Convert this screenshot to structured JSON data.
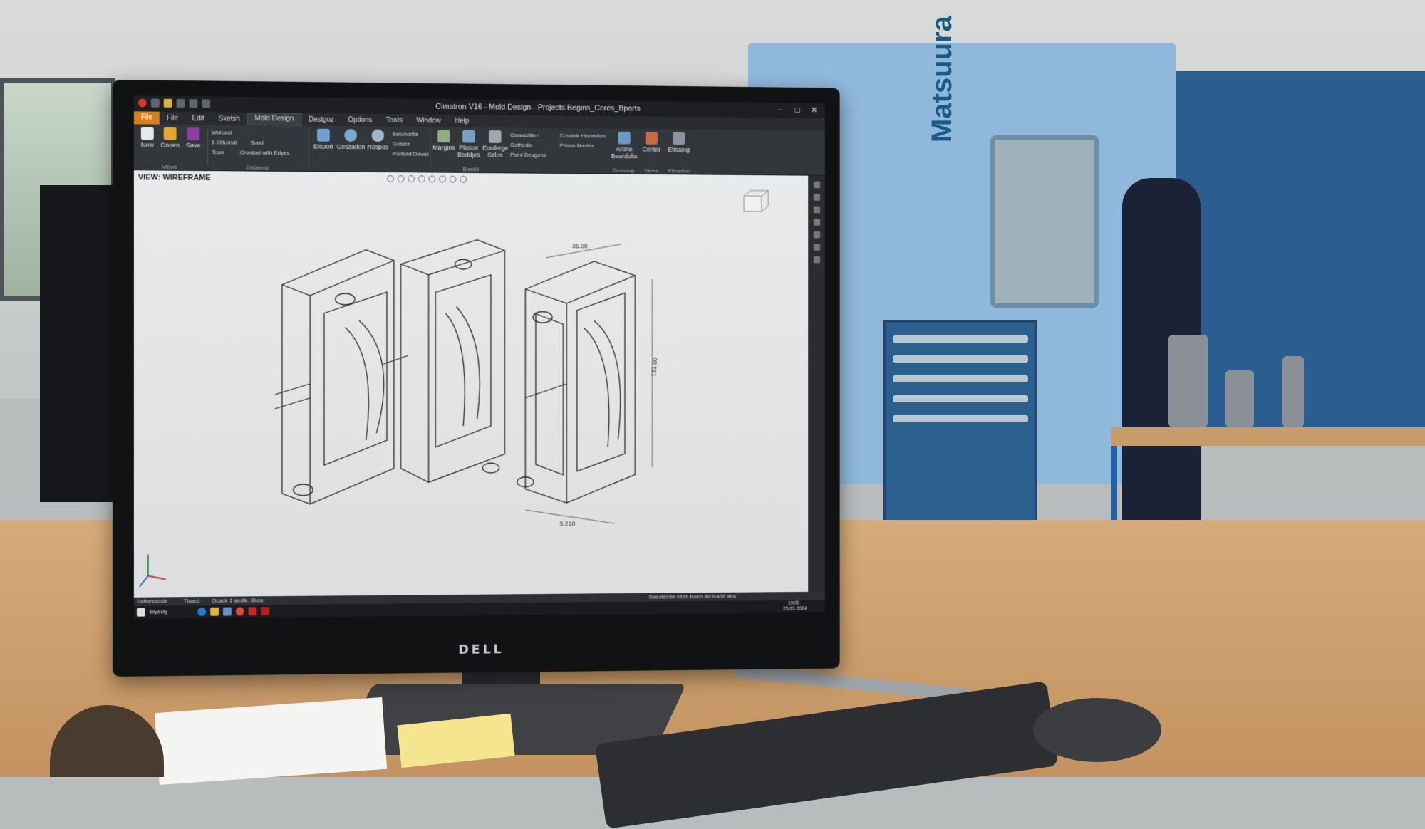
{
  "window": {
    "title": "Cimatron V16 - Mold Design - Projects Begins_Cores_Bparts",
    "minimize": "–",
    "maximize": "□",
    "close": "✕"
  },
  "menu": {
    "file": "File",
    "items": [
      "File",
      "Edit",
      "Sketsh",
      "Mold Design",
      "Destgoz",
      "Options",
      "Tools",
      "Window",
      "Help"
    ]
  },
  "ribbon": {
    "new": "New",
    "open": "Cooen",
    "save": "Save",
    "views_group": "Views",
    "woloasi": "Woloasi",
    "elitomat": "6 Elitomat",
    "sond": "Sond",
    "toon": "Toon",
    "orwdoel": "Orwdoel with Edyes",
    "dstareos": "Dstareos",
    "eisport": "Eisport",
    "geszation": "Geszation",
    "rospos": "Rospos",
    "betonorita": "Betonorita",
    "goseiz": "Goseiz",
    "posead_devas": "Podead Devas",
    "margins": "Margins",
    "plastor_beddjes": "Plastor Beddjes",
    "eordge_szos": "Eorderge Szlos",
    "blaskit": "Blaskit",
    "gonoszitien": "Gonoszitien",
    "gothedie": "Gothedie",
    "point_devgens": "Point Devgens",
    "cosardr": "Cosardr Hiorastion",
    "prison_masles": "Prison Masles",
    "arone_beardolia": "Arone Beardolia",
    "centar": "Centar",
    "efisaing": "Efisaing",
    "destorop": "Destorop",
    "views": "Views",
    "efiiuoiton": "Efiiuoiton"
  },
  "viewport": {
    "label": "VIEW: WIREFRAME",
    "dim_top": "35.00",
    "dim_right": "131.00",
    "dim_bottom": "5.220"
  },
  "statusbar": {
    "left": "Satbesadsb",
    "tab": "Tbaed",
    "ocack": "Ocack 1 aedlk. Bluja",
    "right": "Seeotecda Ssatl Bo6b.asi Ba6b aba"
  },
  "taskbar": {
    "search": "Blyecfy",
    "time": "19:00",
    "date": "25.03.2024"
  },
  "monitor": {
    "brand": "DELL"
  },
  "workshop": {
    "machine_logo": "Matsuura"
  }
}
